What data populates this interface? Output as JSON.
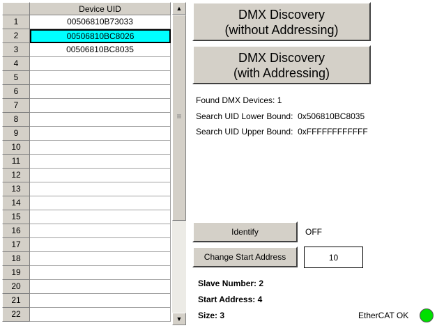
{
  "table": {
    "column_header": "Device UID",
    "rows": [
      {
        "num": "1",
        "uid": "00506810B73033"
      },
      {
        "num": "2",
        "uid": "00506810BC8026"
      },
      {
        "num": "3",
        "uid": "00506810BC8035"
      },
      {
        "num": "4",
        "uid": ""
      },
      {
        "num": "5",
        "uid": ""
      },
      {
        "num": "6",
        "uid": ""
      },
      {
        "num": "7",
        "uid": ""
      },
      {
        "num": "8",
        "uid": ""
      },
      {
        "num": "9",
        "uid": ""
      },
      {
        "num": "10",
        "uid": ""
      },
      {
        "num": "11",
        "uid": ""
      },
      {
        "num": "12",
        "uid": ""
      },
      {
        "num": "13",
        "uid": ""
      },
      {
        "num": "14",
        "uid": ""
      },
      {
        "num": "15",
        "uid": ""
      },
      {
        "num": "16",
        "uid": ""
      },
      {
        "num": "17",
        "uid": ""
      },
      {
        "num": "18",
        "uid": ""
      },
      {
        "num": "19",
        "uid": ""
      },
      {
        "num": "20",
        "uid": ""
      },
      {
        "num": "21",
        "uid": ""
      },
      {
        "num": "22",
        "uid": ""
      }
    ],
    "selected_row": "2",
    "selected_color": "#00ffff",
    "scrollbar": {
      "up_icon": "arrow-up-icon",
      "down_icon": "arrow-down-icon",
      "grip_icon": "grip-icon"
    }
  },
  "buttons": {
    "discovery_no_addr": [
      "DMX Discovery",
      "(without Addressing)"
    ],
    "discovery_addr": [
      "DMX Discovery",
      "(with Addressing)"
    ],
    "identify": "Identify",
    "change_start": "Change Start Address"
  },
  "info": {
    "found": "Found DMX Devices: 1",
    "lower_bound": "Search UID Lower Bound:  0x506810BC8035",
    "upper_bound": "Search UID Upper Bound:  0xFFFFFFFFFFFF"
  },
  "identify_state": "OFF",
  "start_address_input": "10",
  "status": {
    "slave_number": "Slave Number: 2",
    "start_address": "Start Address: 4",
    "size": "Size: 3",
    "ethercat": "EtherCAT OK",
    "led_color": "#00e000"
  }
}
